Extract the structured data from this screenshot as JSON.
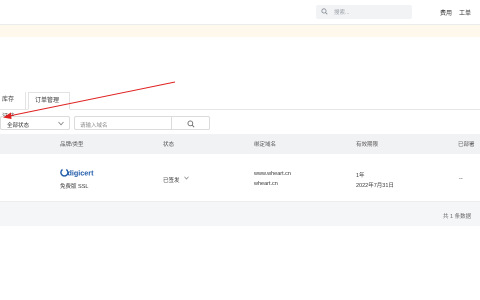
{
  "header": {
    "search_placeholder": "搜索...",
    "links": [
      "费用",
      "工单"
    ]
  },
  "tabs": [
    "库存证书",
    "订单管理"
  ],
  "filters": {
    "status_select": "全部状态",
    "domain_placeholder": "请输入域名"
  },
  "table": {
    "columns": [
      "品牌/类型",
      "状态",
      "绑定域名",
      "有效期限",
      "已部署"
    ],
    "rows": [
      {
        "brand": "digicert",
        "type": "免费版 SSL",
        "status": "已签发",
        "domains": [
          "www.wheart.cn",
          "wheart.cn"
        ],
        "validity": "1年",
        "expiry": "2022年7月31日",
        "deployed": "--"
      }
    ]
  },
  "footer": {
    "total": "共 1 条数据"
  },
  "annotation": {
    "color": "#e02020"
  }
}
